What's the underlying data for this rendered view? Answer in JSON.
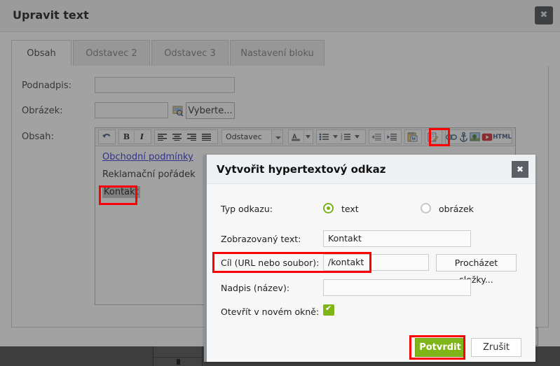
{
  "window": {
    "title": "Upravit text",
    "close_icon": "close-icon",
    "close_label": "✖"
  },
  "tabs": [
    {
      "label": "Obsah",
      "active": true
    },
    {
      "label": "Odstavec 2",
      "active": false
    },
    {
      "label": "Odstavec 3",
      "active": false
    },
    {
      "label": "Nastavení bloku",
      "active": false
    }
  ],
  "form": {
    "subtitle_label": "Podnadpis:",
    "subtitle_value": "",
    "image_label": "Obrázek:",
    "image_value": "",
    "image_browse_label": "Vyberte...",
    "content_label": "Obsah:"
  },
  "editor": {
    "paragraph_style": "Odstavec",
    "toolbar": [
      "undo-icon",
      "bold-icon",
      "italic-icon",
      "align-left-icon",
      "align-center-icon",
      "align-right-icon",
      "align-justify-icon",
      "paragraph-style-select",
      "text-color-icon",
      "unordered-list-icon",
      "ordered-list-icon",
      "outdent-icon",
      "indent-icon",
      "paste-from-word-icon",
      "edit-source-icon",
      "insert-link-icon",
      "insert-anchor-icon",
      "insert-image-icon",
      "insert-youtube-icon",
      "html-icon"
    ],
    "bold_label": "B",
    "italic_label": "I",
    "html_label": "HTML",
    "lines": [
      {
        "text": "Obchodní podmínky",
        "style": "link"
      },
      {
        "text": "Reklamační pořádek",
        "style": "plain"
      },
      {
        "text": "Kontakt",
        "style": "selected"
      }
    ]
  },
  "modal": {
    "title": "Vytvořit hypertextový odkaz",
    "close_label": "✖",
    "link_type_label": "Typ odkazu:",
    "radio_text_label": "text",
    "radio_image_label": "obrázek",
    "radio_selected": "text",
    "display_text_label": "Zobrazovaný text:",
    "display_text_value": "Kontakt",
    "target_label": "Cíl (URL nebo soubor):",
    "target_value": "/kontakt",
    "browse_label": "Procházet složky...",
    "title_attr_label": "Nadpis (název):",
    "title_attr_value": "",
    "new_window_label": "Otevřít v novém okně:",
    "new_window_checked": true,
    "confirm_label": "Potvrdit",
    "cancel_label": "Zrušit"
  },
  "colors": {
    "accent_green": "#7fb519",
    "annotation_red": "#ff0000",
    "modal_header": "#eef1f3",
    "dim": "rgba(60,60,60,0.48)"
  },
  "annotations": [
    {
      "name": "link-toolbar-button-highlight"
    },
    {
      "name": "selected-text-highlight"
    },
    {
      "name": "target-url-field-highlight"
    },
    {
      "name": "confirm-button-highlight"
    }
  ]
}
